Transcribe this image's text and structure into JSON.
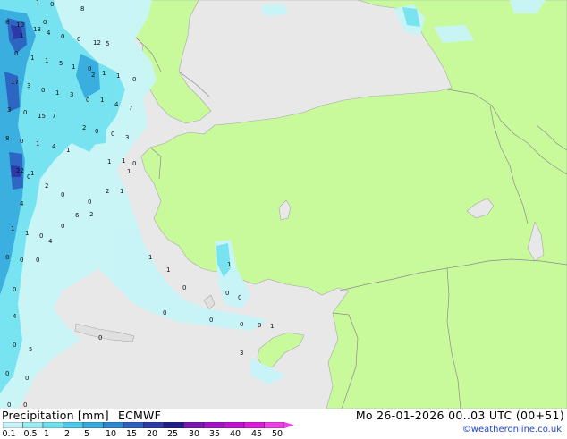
{
  "title": {
    "variable": "Precipitation [mm]",
    "model": "ECMWF"
  },
  "datetime": "Mo 26-01-2026 00..03 UTC (00+51)",
  "credit": "©weatheronline.co.uk",
  "legend": {
    "labels": [
      "0.1",
      "0.5",
      "1",
      "2",
      "5",
      "10",
      "15",
      "20",
      "25",
      "30",
      "35",
      "40",
      "45",
      "50"
    ],
    "colors": [
      "#c8f5f8",
      "#9deef4",
      "#6fe2f0",
      "#48cbe8",
      "#34a9dd",
      "#2b86d1",
      "#2c5fc0",
      "#2b3aa8",
      "#1f1d8c",
      "#7a16b4",
      "#a011c8",
      "#c00fd4",
      "#dd18dc",
      "#ee3ee8"
    ]
  },
  "colors": {
    "land": "#c8fa9c",
    "sea": "#e8e8e8",
    "border": "#909090",
    "light_precip": "#c8f5f8",
    "medium_precip": "#6fe2f0",
    "heavy_precip": "#34a9dd"
  },
  "map_values": [
    "1",
    "0",
    "8",
    "8",
    "0",
    "10",
    "13",
    "1",
    "4",
    "0",
    "0",
    "12",
    "5",
    "0",
    "1",
    "1",
    "5",
    "1",
    "0",
    "2",
    "1",
    "1",
    "0",
    "17",
    "3",
    "0",
    "1",
    "3",
    "0",
    "1",
    "4",
    "7",
    "3",
    "0",
    "15",
    "7",
    "2",
    "0",
    "0",
    "3",
    "8",
    "0",
    "1",
    "4",
    "1",
    "1",
    "0",
    "1",
    "1",
    "0",
    "2",
    "0",
    "0",
    "22",
    "1",
    "4",
    "1",
    "1",
    "0",
    "2",
    "6",
    "0",
    "4",
    "2",
    "1",
    "0",
    "0",
    "0",
    "0",
    "1",
    "1",
    "0",
    "1",
    "0",
    "0",
    "0",
    "0",
    "0",
    "0",
    "1",
    "4",
    "5",
    "0",
    "3",
    "0",
    "0",
    "0",
    "0",
    "0"
  ]
}
